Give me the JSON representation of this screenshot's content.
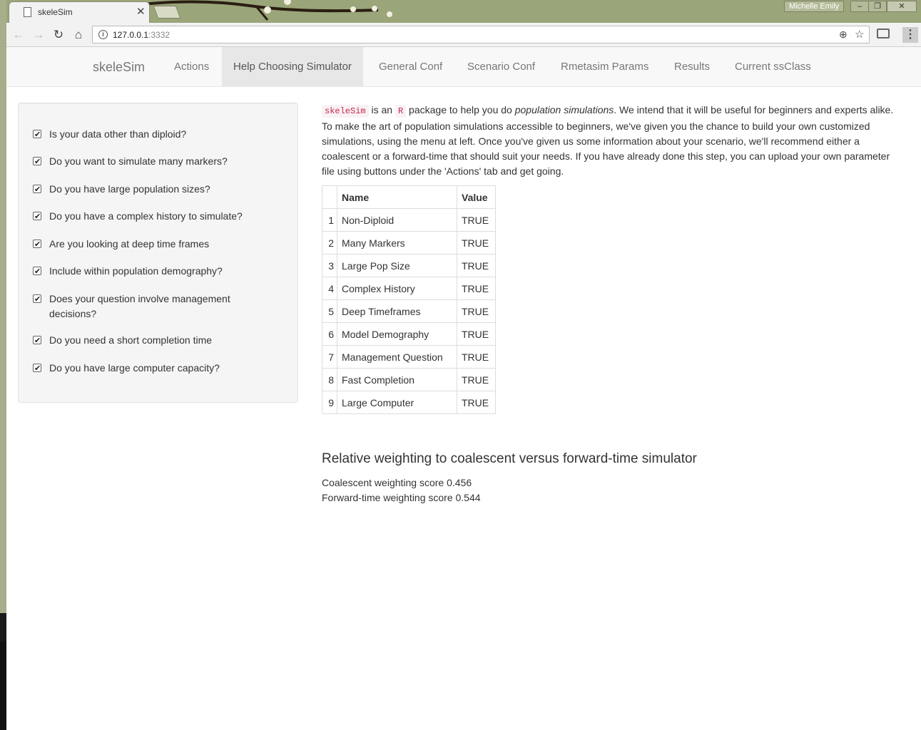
{
  "browser": {
    "tab_title": "skeleSim",
    "url_host": "127.0.0.1",
    "url_port": ":3332",
    "user": "Michelle Emily"
  },
  "navbar": {
    "brand": "skeleSim",
    "items": [
      {
        "label": "Actions"
      },
      {
        "label": "Help Choosing Simulator"
      },
      {
        "label": "General Conf"
      },
      {
        "label": "Scenario Conf"
      },
      {
        "label": "Rmetasim Params"
      },
      {
        "label": "Results"
      },
      {
        "label": "Current ssClass"
      }
    ],
    "active_index": 1
  },
  "sidebar": {
    "questions": [
      {
        "label": "Is your data other than diploid?",
        "checked": true
      },
      {
        "label": "Do you want to simulate many markers?",
        "checked": true
      },
      {
        "label": "Do you have large population sizes?",
        "checked": true
      },
      {
        "label": "Do you have a complex history to simulate?",
        "checked": true
      },
      {
        "label": "Are you looking at deep time frames",
        "checked": true
      },
      {
        "label": "Include within population demography?",
        "checked": true
      },
      {
        "label": "Does your question involve management decisions?",
        "checked": true
      },
      {
        "label": "Do you need a short completion time",
        "checked": true
      },
      {
        "label": "Do you have large computer capacity?",
        "checked": true
      }
    ]
  },
  "main": {
    "intro": {
      "pkg": "skeleSim",
      "t1": " is an ",
      "lang": "R",
      "t2": " package to help you do ",
      "em": "population simulations",
      "t3": ". We intend that it will be useful for beginners and experts alike. To make the art of population simulations accessible to beginners, we've given you the chance to build your own customized simulations, using the menu at left. Once you've given us some information about your scenario, we'll recommend either a coalescent or a forward-time that should suit your needs. If you have already done this step, you can upload your own parameter file using buttons under the 'Actions' tab and get going."
    },
    "table": {
      "headers": [
        "",
        "Name",
        "Value"
      ],
      "rows": [
        {
          "n": "1",
          "name": "Non-Diploid",
          "value": "TRUE"
        },
        {
          "n": "2",
          "name": "Many Markers",
          "value": "TRUE"
        },
        {
          "n": "3",
          "name": "Large Pop Size",
          "value": "TRUE"
        },
        {
          "n": "4",
          "name": "Complex History",
          "value": "TRUE"
        },
        {
          "n": "5",
          "name": "Deep Timeframes",
          "value": "TRUE"
        },
        {
          "n": "6",
          "name": "Model Demography",
          "value": "TRUE"
        },
        {
          "n": "7",
          "name": "Management Question",
          "value": "TRUE"
        },
        {
          "n": "8",
          "name": "Fast Completion",
          "value": "TRUE"
        },
        {
          "n": "9",
          "name": "Large Computer",
          "value": "TRUE"
        }
      ]
    },
    "weighting_heading": "Relative weighting to coalescent versus forward-time simulator",
    "coalescent_score": "Coalescent weighting score 0.456",
    "forward_score": "Forward-time weighting score 0.544"
  }
}
